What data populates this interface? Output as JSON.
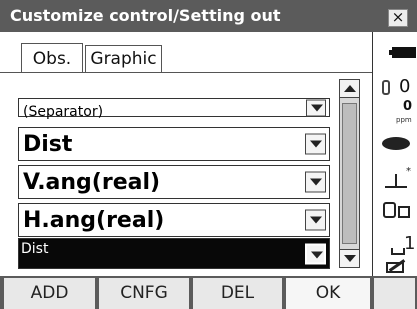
{
  "window": {
    "title": "Customize control/Setting out"
  },
  "tabs": [
    {
      "label": "Obs.",
      "active": true
    },
    {
      "label": "Graphic",
      "active": false
    }
  ],
  "rows": [
    {
      "label": "(Separator)"
    },
    {
      "label": "Dist"
    },
    {
      "label": "V.ang(real)"
    },
    {
      "label": "H.ang(real)"
    },
    {
      "label": "Dist",
      "selected": true
    }
  ],
  "status": {
    "prism_constant": "0",
    "ppm_value": "0",
    "ppm_unit": "ppm"
  },
  "softkeys": [
    {
      "label": "ADD"
    },
    {
      "label": "CNFG"
    },
    {
      "label": "DEL"
    },
    {
      "label": "OK"
    },
    {
      "label": ""
    }
  ],
  "colors": {
    "titlebar": "#5b5b5b",
    "selected_row": "#080808"
  },
  "icons": [
    "close-icon",
    "battery-icon",
    "prism-icon",
    "laser-icon",
    "tilt-icon",
    "communication-icon",
    "input-mode-icon",
    "pen-icon"
  ]
}
